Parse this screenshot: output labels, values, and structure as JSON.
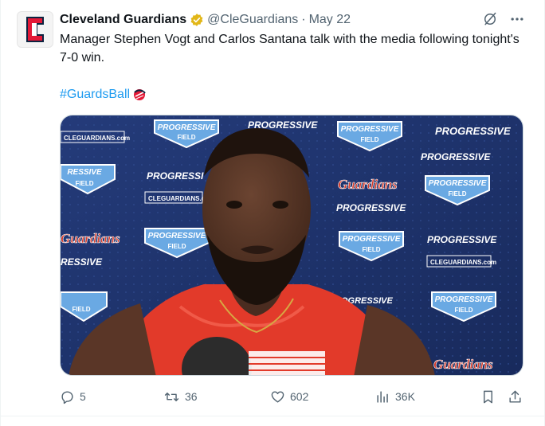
{
  "account": {
    "name": "Cleveland Guardians",
    "handle": "@CleGuardians",
    "separator": "·",
    "date": "May 22"
  },
  "tweet": {
    "text": "Manager Stephen Vogt and Carlos Santana talk with the media following tonight's 7-0 win.",
    "hashtag": "#GuardsBall"
  },
  "backdrop": {
    "sponsor_text": "PROGRESSIVE",
    "field_text": "FIELD",
    "team_script": "Guardians",
    "url_text": "CLEGUARDIANS.com",
    "progress_partial_1": "PROGRESSI",
    "progress_partial_2": "RESSIVE",
    "progress_partial_3": "OGRESSIVE"
  },
  "metrics": {
    "replies": "5",
    "retweets": "36",
    "likes": "602",
    "views": "36K"
  },
  "colors": {
    "accent": "#1d9bf0",
    "backdrop_navy": "#1c2f66",
    "team_red": "#d63a2a",
    "badge_gold": "#e2b719"
  }
}
